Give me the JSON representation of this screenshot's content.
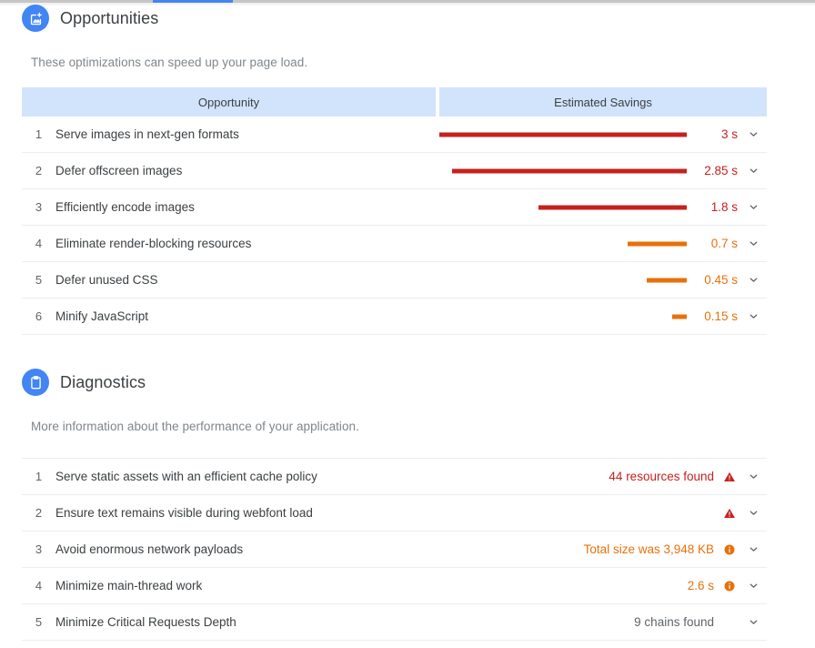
{
  "theme": {
    "accent_blue": "#4285f4",
    "header_blue": "#d2e3fc",
    "severity_red": "#c5221f",
    "severity_orange": "#e8710a",
    "text_primary": "#3c4043",
    "text_muted": "#80868b",
    "row_divider": "#ededed"
  },
  "opportunities": {
    "icon": "image-add-icon",
    "title": "Opportunities",
    "description": "These optimizations can speed up your page load.",
    "columns": {
      "name": "Opportunity",
      "savings": "Estimated Savings"
    },
    "rows": [
      {
        "index": "1",
        "label": "Serve images in next-gen formats",
        "value": "3 s",
        "seconds": 3.0,
        "bar_pct": 100,
        "color": "#c5221f",
        "chevron": "chevron-down-icon"
      },
      {
        "index": "2",
        "label": "Defer offscreen images",
        "value": "2.85 s",
        "seconds": 2.85,
        "bar_pct": 95,
        "color": "#c5221f",
        "chevron": "chevron-down-icon"
      },
      {
        "index": "3",
        "label": "Efficiently encode images",
        "value": "1.8 s",
        "seconds": 1.8,
        "bar_pct": 60,
        "color": "#c5221f",
        "chevron": "chevron-down-icon"
      },
      {
        "index": "4",
        "label": "Eliminate render-blocking resources",
        "value": "0.7 s",
        "seconds": 0.7,
        "bar_pct": 24,
        "color": "#e8710a",
        "chevron": "chevron-down-icon"
      },
      {
        "index": "5",
        "label": "Defer unused CSS",
        "value": "0.45 s",
        "seconds": 0.45,
        "bar_pct": 16,
        "color": "#e8710a",
        "chevron": "chevron-down-icon"
      },
      {
        "index": "6",
        "label": "Minify JavaScript",
        "value": "0.15 s",
        "seconds": 0.15,
        "bar_pct": 6,
        "color": "#e8710a",
        "chevron": "chevron-down-icon"
      }
    ]
  },
  "diagnostics": {
    "icon": "clipboard-icon",
    "title": "Diagnostics",
    "description": "More information about the performance of your application.",
    "rows": [
      {
        "index": "1",
        "label": "Serve static assets with an efficient cache policy",
        "value": "44 resources found",
        "color": "#c5221f",
        "severity": "warning-triangle-icon",
        "chevron": "chevron-down-icon"
      },
      {
        "index": "2",
        "label": "Ensure text remains visible during webfont load",
        "value": "",
        "color": "#c5221f",
        "severity": "warning-triangle-icon",
        "chevron": "chevron-down-icon"
      },
      {
        "index": "3",
        "label": "Avoid enormous network payloads",
        "value": "Total size was 3,948 KB",
        "color": "#e8710a",
        "severity": "info-circle-icon",
        "chevron": "chevron-down-icon"
      },
      {
        "index": "4",
        "label": "Minimize main-thread work",
        "value": "2.6 s",
        "color": "#e8710a",
        "severity": "info-circle-icon",
        "chevron": "chevron-down-icon"
      },
      {
        "index": "5",
        "label": "Minimize Critical Requests Depth",
        "value": "9 chains found",
        "color": "#5f6368",
        "severity": "none",
        "chevron": "chevron-down-icon"
      }
    ]
  }
}
